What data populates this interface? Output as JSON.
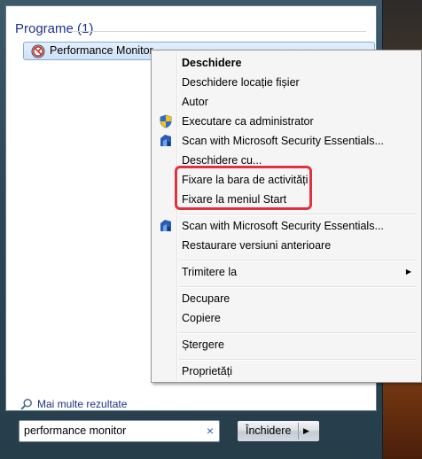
{
  "start_menu": {
    "section_title": "Programe (1)",
    "result_item": {
      "label": "Performance Monitor",
      "icon": "performance-monitor-icon"
    },
    "more_results": "Mai multe rezultate",
    "search": {
      "value": "performance monitor",
      "clear_glyph": "×"
    },
    "shutdown": {
      "label": "Închidere",
      "arrow_glyph": "▶"
    }
  },
  "context_menu": {
    "items": [
      {
        "label": "Deschidere",
        "bold": true
      },
      {
        "label": "Deschidere locație fișier"
      },
      {
        "label": "Autor"
      },
      {
        "label": "Executare ca administrator",
        "icon": "uac-shield-icon"
      },
      {
        "label": "Scan with Microsoft Security Essentials...",
        "icon": "security-essentials-icon"
      },
      {
        "label": "Deschidere cu..."
      },
      {
        "label": "Fixare la bara de activități"
      },
      {
        "label": "Fixare la meniul Start"
      },
      {
        "label": "Scan with Microsoft Security Essentials...",
        "icon": "security-essentials-icon"
      },
      {
        "label": "Restaurare versiuni anterioare"
      },
      {
        "label": "Trimitere la",
        "submenu": true,
        "chevron": "▶"
      },
      {
        "label": "Decupare"
      },
      {
        "label": "Copiere"
      },
      {
        "label": "Ștergere"
      },
      {
        "label": "Proprietăți"
      }
    ],
    "highlight_color": "#e0313e"
  }
}
